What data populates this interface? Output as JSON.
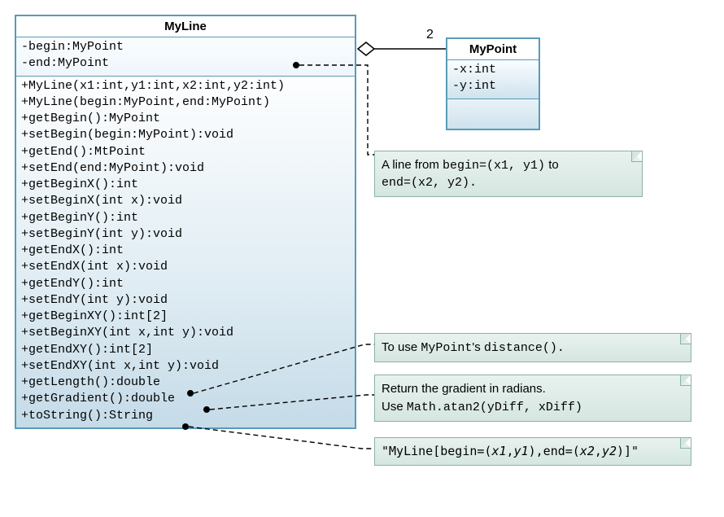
{
  "myline": {
    "title": "MyLine",
    "attrs": [
      "-begin:MyPoint",
      "-end:MyPoint"
    ],
    "methods": [
      "+MyLine(x1:int,y1:int,x2:int,y2:int)",
      "+MyLine(begin:MyPoint,end:MyPoint)",
      "+getBegin():MyPoint",
      "+setBegin(begin:MyPoint):void",
      "+getEnd():MtPoint",
      "+setEnd(end:MyPoint):void",
      "+getBeginX():int",
      "+setBeginX(int x):void",
      "+getBeginY():int",
      "+setBeginY(int y):void",
      "+getEndX():int",
      "+setEndX(int x):void",
      "+getEndY():int",
      "+setEndY(int y):void",
      "+getBeginXY():int[2]",
      "+setBeginXY(int x,int y):void",
      "+getEndXY():int[2]",
      "+setEndXY(int x,int y):void",
      "+getLength():double",
      "+getGradient():double",
      "+toString():String"
    ]
  },
  "mypoint": {
    "title": "MyPoint",
    "attrs": [
      "-x:int",
      "-y:int"
    ]
  },
  "notes": {
    "constructor": {
      "pre": "A line from ",
      "code1": "begin=(x1, y1)",
      "mid": " to ",
      "code2": "end=(x2, y2)."
    },
    "length": {
      "pre": "To use ",
      "code": "MyPoint",
      "post": "'s ",
      "code2": "distance()."
    },
    "gradient": {
      "line1_pre": "Return the gradient in radians.",
      "line2_pre": "Use ",
      "line2_code": "Math.atan2(yDiff, xDiff)"
    },
    "tostring": "\"MyLine[begin=(x1,y1),end=(x2,y2)]\""
  },
  "multiplicity": "2",
  "chart_data": {
    "type": "diagram",
    "diagram_type": "UML class diagram",
    "classes": [
      {
        "name": "MyLine",
        "attributes": [
          {
            "visibility": "-",
            "name": "begin",
            "type": "MyPoint"
          },
          {
            "visibility": "-",
            "name": "end",
            "type": "MyPoint"
          }
        ],
        "operations": [
          {
            "visibility": "+",
            "signature": "MyLine(x1:int,y1:int,x2:int,y2:int)"
          },
          {
            "visibility": "+",
            "signature": "MyLine(begin:MyPoint,end:MyPoint)"
          },
          {
            "visibility": "+",
            "signature": "getBegin():MyPoint"
          },
          {
            "visibility": "+",
            "signature": "setBegin(begin:MyPoint):void"
          },
          {
            "visibility": "+",
            "signature": "getEnd():MtPoint"
          },
          {
            "visibility": "+",
            "signature": "setEnd(end:MyPoint):void"
          },
          {
            "visibility": "+",
            "signature": "getBeginX():int"
          },
          {
            "visibility": "+",
            "signature": "setBeginX(int x):void"
          },
          {
            "visibility": "+",
            "signature": "getBeginY():int"
          },
          {
            "visibility": "+",
            "signature": "setBeginY(int y):void"
          },
          {
            "visibility": "+",
            "signature": "getEndX():int"
          },
          {
            "visibility": "+",
            "signature": "setEndX(int x):void"
          },
          {
            "visibility": "+",
            "signature": "getEndY():int"
          },
          {
            "visibility": "+",
            "signature": "setEndY(int y):void"
          },
          {
            "visibility": "+",
            "signature": "getBeginXY():int[2]"
          },
          {
            "visibility": "+",
            "signature": "setBeginXY(int x,int y):void"
          },
          {
            "visibility": "+",
            "signature": "getEndXY():int[2]"
          },
          {
            "visibility": "+",
            "signature": "setEndXY(int x,int y):void"
          },
          {
            "visibility": "+",
            "signature": "getLength():double",
            "note": "To use MyPoint's distance()."
          },
          {
            "visibility": "+",
            "signature": "getGradient():double",
            "note": "Return the gradient in radians. Use Math.atan2(yDiff, xDiff)"
          },
          {
            "visibility": "+",
            "signature": "toString():String",
            "note": "\"MyLine[begin=(x1,y1),end=(x2,y2)]\""
          }
        ]
      },
      {
        "name": "MyPoint",
        "attributes": [
          {
            "visibility": "-",
            "name": "x",
            "type": "int"
          },
          {
            "visibility": "-",
            "name": "y",
            "type": "int"
          }
        ],
        "operations": []
      }
    ],
    "relationships": [
      {
        "type": "aggregation",
        "whole": "MyLine",
        "part": "MyPoint",
        "multiplicity_part": "2"
      }
    ]
  }
}
